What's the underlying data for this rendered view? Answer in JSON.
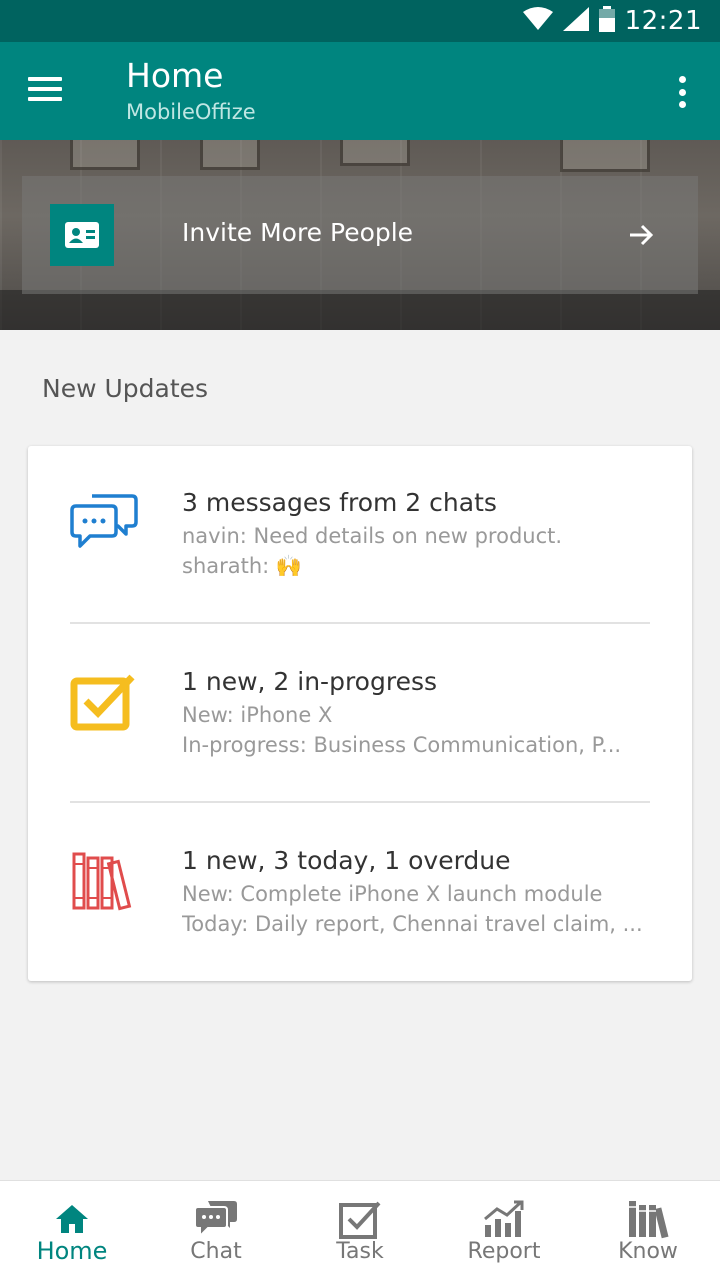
{
  "status_bar": {
    "time": "12:21"
  },
  "app_bar": {
    "title": "Home",
    "subtitle": "MobileOffize"
  },
  "invite": {
    "label": "Invite More People"
  },
  "section": {
    "title": "New Updates"
  },
  "updates": [
    {
      "icon": "chat-bubbles-icon",
      "title": "3 messages from 2 chats",
      "line1": "navin: Need details on new product.",
      "line2": "sharath: 🙌"
    },
    {
      "icon": "task-check-icon",
      "title": "1 new, 2 in-progress",
      "line1": "New: iPhone X",
      "line2": "In-progress: Business Communication, P..."
    },
    {
      "icon": "books-icon",
      "title": "1 new, 3 today, 1 overdue",
      "line1": "New: Complete iPhone X launch module",
      "line2": "Today: Daily report, Chennai travel claim, ..."
    }
  ],
  "nav": [
    {
      "label": "Home",
      "icon": "home-icon",
      "active": true
    },
    {
      "label": "Chat",
      "icon": "chat-icon",
      "active": false
    },
    {
      "label": "Task",
      "icon": "task-icon",
      "active": false
    },
    {
      "label": "Report",
      "icon": "report-icon",
      "active": false
    },
    {
      "label": "Know",
      "icon": "know-icon",
      "active": false
    }
  ],
  "colors": {
    "primary": "#00857f",
    "primary_dark": "#00635f",
    "chat_blue": "#1f7fd0",
    "task_yellow": "#f5bd1f",
    "know_red": "#e04c4c"
  }
}
